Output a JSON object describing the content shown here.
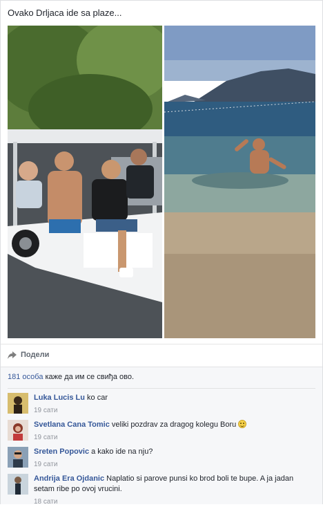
{
  "post": {
    "caption": "Ovako Drljaca ide sa plaze...",
    "share_label": "Подели",
    "likes_count": "181 особа",
    "likes_text": " каже да им се свиђа ово."
  },
  "icons": {
    "share": "share-arrow-icon",
    "emoji": "smiley-emoji-icon"
  },
  "colors": {
    "link": "#365899",
    "meta": "#90949c",
    "comments_bg": "#f6f7f9"
  },
  "comments": [
    {
      "author": "Luka Lucis Lu",
      "text": " ko car",
      "time": "19 сати"
    },
    {
      "author": "Svetlana Cana Tomic",
      "text": " veliki pozdrav za dragog kolegu Boru ",
      "time": "19 сати"
    },
    {
      "author": "Sreten Popovic",
      "text": " a kako ide na nju?",
      "time": "19 сати"
    },
    {
      "author": "Andrija Era Ojdanic",
      "text": " Naplatio si parove punsi ko brod boli te bupe. A ja jadan setam ribe po ovoj vrucini.",
      "time": "18 сати"
    }
  ]
}
